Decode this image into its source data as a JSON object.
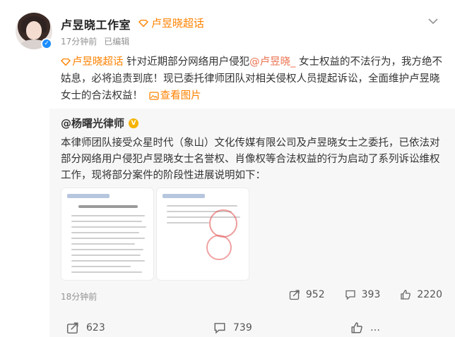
{
  "header": {
    "username": "卢昱晓工作室",
    "supertopic_label": "卢昱晓超话",
    "time": "17分钟前",
    "edited": "已编辑"
  },
  "post": {
    "tag": "卢昱晓超话",
    "text_part1": " 针对近期部分网络用户侵犯",
    "mention": "@卢昱晓_",
    "text_part2": " 女士权益的不法行为，我方绝不姑息，必将追责到底！现已委托律师团队对相关侵权人员提起诉讼，全面维护卢昱晓女士的合法权益！",
    "view_images_link": "查看图片"
  },
  "repost": {
    "author": "@杨曙光律师",
    "text": "本律师团队接受众星时代（象山）文化传媒有限公司及卢昱晓女士之委托，已依法对部分网络用户侵犯卢昱晓女士名誉权、肖像权等合法权益的行为启动了系列诉讼维权工作，现将部分案件的阶段性进展说明如下：",
    "time": "18分钟前",
    "shares": "952",
    "comments": "393",
    "likes": "2220"
  },
  "bottom": {
    "forwards": "623",
    "comments": "739",
    "likes": "…"
  },
  "colors": {
    "accent_orange": "#ff8200",
    "mention": "#eb7350",
    "verify_blue": "#1a8cff",
    "gold_badge": "#f5b400"
  },
  "icons": {
    "supertopic": "diamond-icon",
    "more": "chevron-down-icon",
    "share": "share-icon",
    "comment": "comment-icon",
    "like": "thumbs-up-icon",
    "verified": "verified-badge-icon"
  }
}
